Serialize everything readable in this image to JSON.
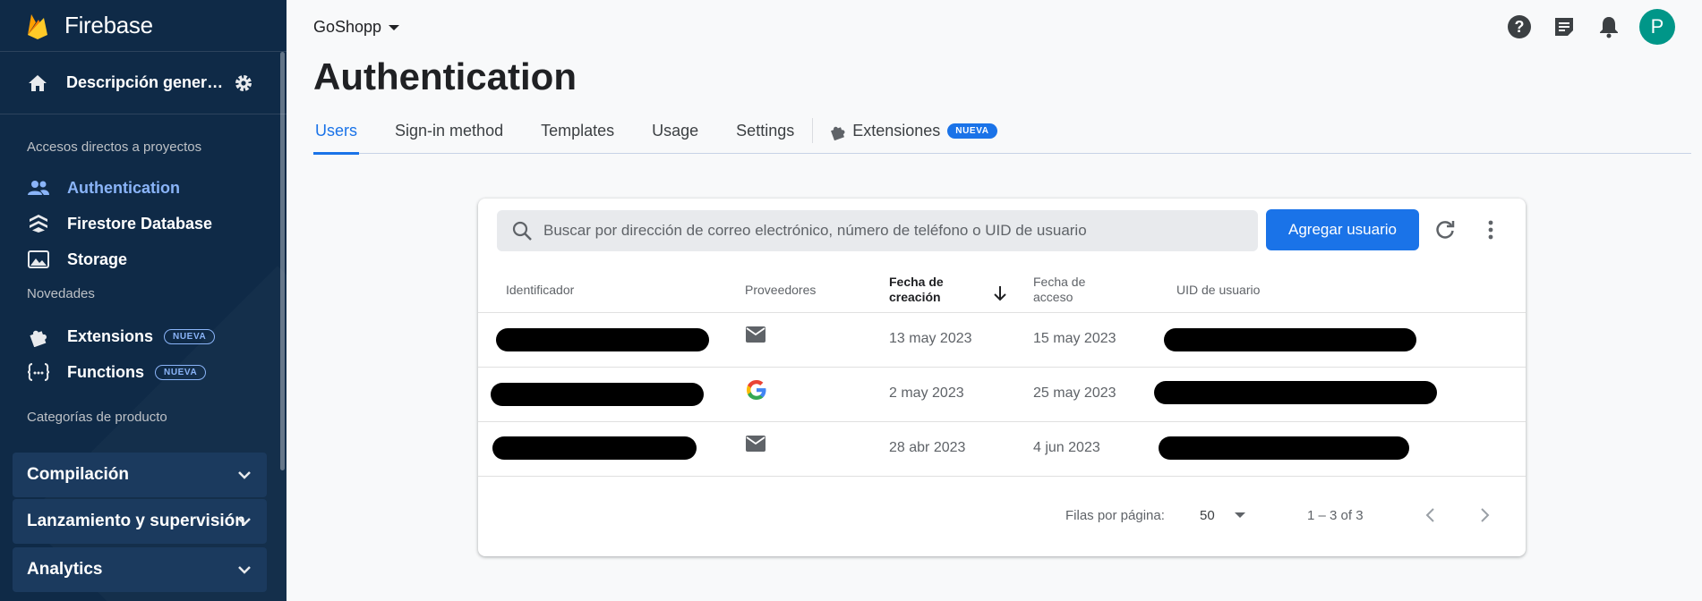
{
  "sidebar": {
    "brand": "Firebase",
    "overview_label": "Descripción general ...",
    "section_shortcuts": "Accesos directos a proyectos",
    "shortcuts": [
      {
        "label": "Authentication",
        "icon": "people-icon",
        "active": true
      },
      {
        "label": "Firestore Database",
        "icon": "firestore-icon"
      },
      {
        "label": "Storage",
        "icon": "image-icon"
      }
    ],
    "section_news": "Novedades",
    "news": [
      {
        "label": "Extensions",
        "icon": "puzzle-icon",
        "badge": "NUEVA"
      },
      {
        "label": "Functions",
        "icon": "functions-icon",
        "badge": "NUEVA"
      }
    ],
    "section_categories": "Categorías de producto",
    "groups": [
      "Compilación",
      "Lanzamiento y supervisión",
      "Analytics"
    ]
  },
  "header": {
    "project": "GoShopp",
    "avatar_letter": "P"
  },
  "page": {
    "title": "Authentication",
    "tabs": [
      "Users",
      "Sign-in method",
      "Templates",
      "Usage",
      "Settings"
    ],
    "ext_tab": "Extensiones",
    "ext_badge": "NUEVA"
  },
  "users": {
    "search_placeholder": "Buscar por dirección de correo electrónico, número de teléfono o UID de usuario",
    "add_button": "Agregar usuario",
    "columns": {
      "id": "Identificador",
      "providers": "Proveedores",
      "created_1": "Fecha de",
      "created_2": "creación",
      "signed_1": "Fecha de",
      "signed_2": "acceso",
      "uid": "UID de usuario"
    },
    "rows": [
      {
        "provider": "email-icon",
        "created": "13 may 2023",
        "signed_in": "15 may 2023"
      },
      {
        "provider": "google-icon",
        "created": "2 may 2023",
        "signed_in": "25 may 2023"
      },
      {
        "provider": "email-icon",
        "created": "28 abr 2023",
        "signed_in": "4 jun 2023"
      }
    ],
    "rows_per_page_label": "Filas por página:",
    "rows_per_page": "50",
    "range": "1 – 3 of 3"
  },
  "colors": {
    "sidebar_bg": "#0f2a47",
    "accent": "#1a73e8",
    "active_nav": "#8ab4f8",
    "avatar": "#009688"
  }
}
